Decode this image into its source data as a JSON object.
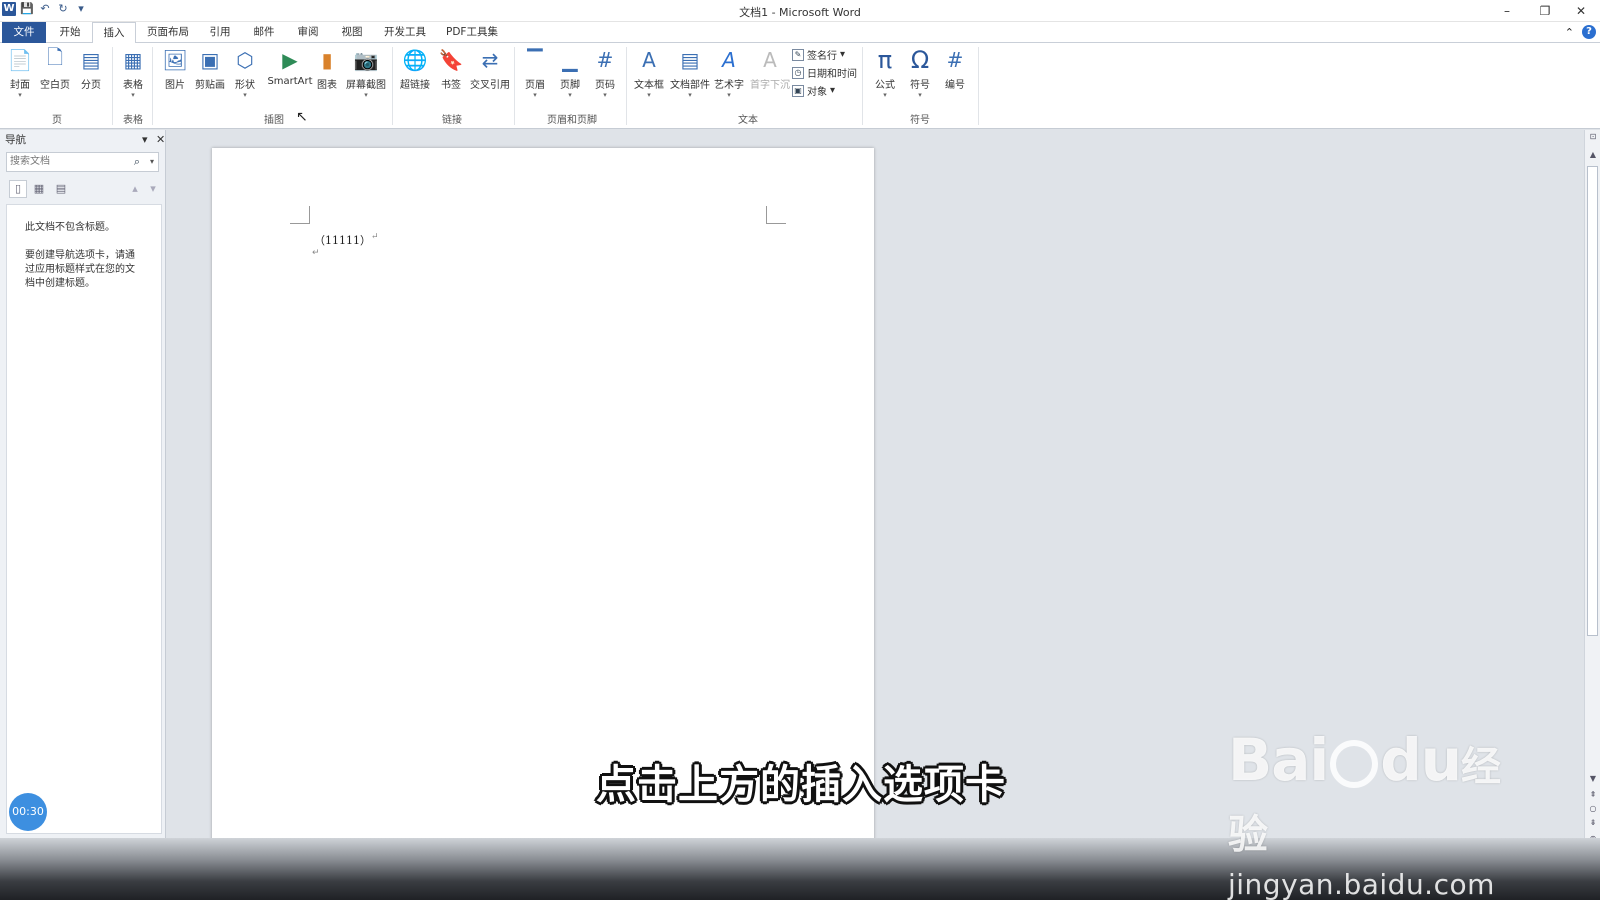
{
  "window": {
    "title": "文档1 - Microsoft Word",
    "minimize": "–",
    "restore": "❐",
    "close": "✕"
  },
  "qat": {
    "logo": "W",
    "save": "💾",
    "undo": "↶",
    "redo": "↻",
    "more": "▾"
  },
  "tabs": [
    "文件",
    "开始",
    "插入",
    "页面布局",
    "引用",
    "邮件",
    "审阅",
    "视图",
    "开发工具",
    "PDF工具集"
  ],
  "tabs_right": {
    "minimize_ribbon": "⌃",
    "help": "?"
  },
  "ribbon": {
    "buttons": [
      {
        "id": "cover",
        "label": "封面",
        "icon": "📄"
      },
      {
        "id": "blank",
        "label": "空白页",
        "icon": "🗋"
      },
      {
        "id": "break",
        "label": "分页",
        "icon": "▤"
      },
      {
        "id": "table",
        "label": "表格",
        "icon": "▦"
      },
      {
        "id": "picture",
        "label": "图片",
        "icon": "🖼"
      },
      {
        "id": "clipart",
        "label": "剪贴画",
        "icon": "▣"
      },
      {
        "id": "shapes",
        "label": "形状",
        "icon": "⬡"
      },
      {
        "id": "smartart",
        "label": "SmartArt",
        "icon": "▶"
      },
      {
        "id": "chart",
        "label": "图表",
        "icon": "▮"
      },
      {
        "id": "screenshot",
        "label": "屏幕截图",
        "icon": "📷"
      },
      {
        "id": "hyperlink",
        "label": "超链接",
        "icon": "🌐"
      },
      {
        "id": "bookmark",
        "label": "书签",
        "icon": "🔖"
      },
      {
        "id": "crossref",
        "label": "交叉引用",
        "icon": "⇄"
      },
      {
        "id": "header",
        "label": "页眉",
        "icon": "▔"
      },
      {
        "id": "footer",
        "label": "页脚",
        "icon": "▁"
      },
      {
        "id": "pagenum",
        "label": "页码",
        "icon": "#"
      },
      {
        "id": "textbox",
        "label": "文本框",
        "icon": "A"
      },
      {
        "id": "quickparts",
        "label": "文档部件",
        "icon": "▤"
      },
      {
        "id": "wordart",
        "label": "艺术字",
        "icon": "A"
      },
      {
        "id": "dropcap",
        "label": "首字下沉",
        "icon": "A"
      },
      {
        "id": "equation",
        "label": "公式",
        "icon": "π"
      },
      {
        "id": "symbol",
        "label": "符号",
        "icon": "Ω"
      },
      {
        "id": "number",
        "label": "编号",
        "icon": "#"
      }
    ],
    "small": [
      {
        "label": "签名行",
        "icon": "✎"
      },
      {
        "label": "日期和时间",
        "icon": "◷"
      },
      {
        "label": "对象",
        "icon": "▣"
      }
    ],
    "groups": [
      "页",
      "表格",
      "插图",
      "链接",
      "页眉和页脚",
      "文本",
      "符号"
    ]
  },
  "nav": {
    "title": "导航",
    "search_placeholder": "搜索文档",
    "message1": "此文档不包含标题。",
    "message2": "要创建导航选项卡，请通过应用标题样式在您的文档中创建标题。"
  },
  "document": {
    "text": "（11111）",
    "mark": "↵"
  },
  "timer": "00:30",
  "caption": "点击上方的插入选项卡",
  "watermark": {
    "logo_a": "Bai",
    "logo_b": "du",
    "logo_c": "经验",
    "url": "jingyan.baidu.com"
  }
}
